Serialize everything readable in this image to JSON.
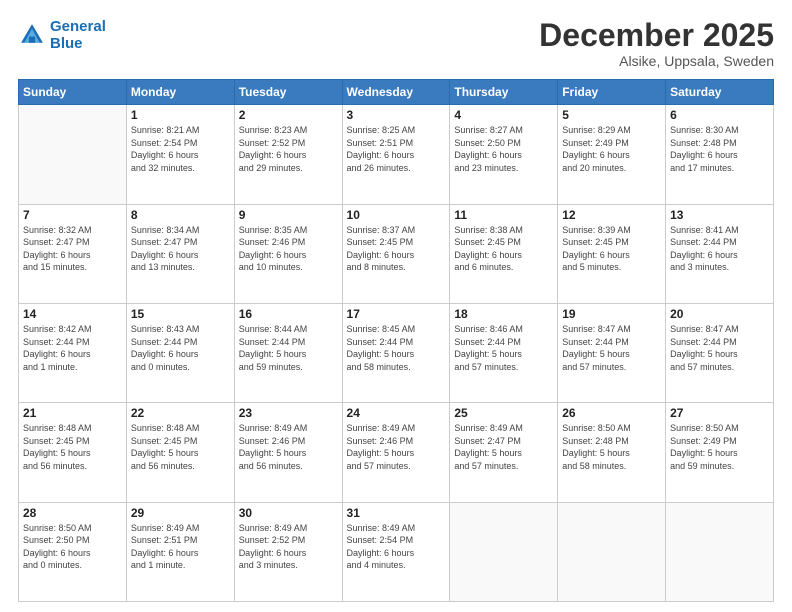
{
  "logo": {
    "line1": "General",
    "line2": "Blue"
  },
  "title": "December 2025",
  "subtitle": "Alsike, Uppsala, Sweden",
  "weekdays": [
    "Sunday",
    "Monday",
    "Tuesday",
    "Wednesday",
    "Thursday",
    "Friday",
    "Saturday"
  ],
  "weeks": [
    [
      {
        "day": "",
        "info": ""
      },
      {
        "day": "1",
        "info": "Sunrise: 8:21 AM\nSunset: 2:54 PM\nDaylight: 6 hours\nand 32 minutes."
      },
      {
        "day": "2",
        "info": "Sunrise: 8:23 AM\nSunset: 2:52 PM\nDaylight: 6 hours\nand 29 minutes."
      },
      {
        "day": "3",
        "info": "Sunrise: 8:25 AM\nSunset: 2:51 PM\nDaylight: 6 hours\nand 26 minutes."
      },
      {
        "day": "4",
        "info": "Sunrise: 8:27 AM\nSunset: 2:50 PM\nDaylight: 6 hours\nand 23 minutes."
      },
      {
        "day": "5",
        "info": "Sunrise: 8:29 AM\nSunset: 2:49 PM\nDaylight: 6 hours\nand 20 minutes."
      },
      {
        "day": "6",
        "info": "Sunrise: 8:30 AM\nSunset: 2:48 PM\nDaylight: 6 hours\nand 17 minutes."
      }
    ],
    [
      {
        "day": "7",
        "info": "Sunrise: 8:32 AM\nSunset: 2:47 PM\nDaylight: 6 hours\nand 15 minutes."
      },
      {
        "day": "8",
        "info": "Sunrise: 8:34 AM\nSunset: 2:47 PM\nDaylight: 6 hours\nand 13 minutes."
      },
      {
        "day": "9",
        "info": "Sunrise: 8:35 AM\nSunset: 2:46 PM\nDaylight: 6 hours\nand 10 minutes."
      },
      {
        "day": "10",
        "info": "Sunrise: 8:37 AM\nSunset: 2:45 PM\nDaylight: 6 hours\nand 8 minutes."
      },
      {
        "day": "11",
        "info": "Sunrise: 8:38 AM\nSunset: 2:45 PM\nDaylight: 6 hours\nand 6 minutes."
      },
      {
        "day": "12",
        "info": "Sunrise: 8:39 AM\nSunset: 2:45 PM\nDaylight: 6 hours\nand 5 minutes."
      },
      {
        "day": "13",
        "info": "Sunrise: 8:41 AM\nSunset: 2:44 PM\nDaylight: 6 hours\nand 3 minutes."
      }
    ],
    [
      {
        "day": "14",
        "info": "Sunrise: 8:42 AM\nSunset: 2:44 PM\nDaylight: 6 hours\nand 1 minute."
      },
      {
        "day": "15",
        "info": "Sunrise: 8:43 AM\nSunset: 2:44 PM\nDaylight: 6 hours\nand 0 minutes."
      },
      {
        "day": "16",
        "info": "Sunrise: 8:44 AM\nSunset: 2:44 PM\nDaylight: 5 hours\nand 59 minutes."
      },
      {
        "day": "17",
        "info": "Sunrise: 8:45 AM\nSunset: 2:44 PM\nDaylight: 5 hours\nand 58 minutes."
      },
      {
        "day": "18",
        "info": "Sunrise: 8:46 AM\nSunset: 2:44 PM\nDaylight: 5 hours\nand 57 minutes."
      },
      {
        "day": "19",
        "info": "Sunrise: 8:47 AM\nSunset: 2:44 PM\nDaylight: 5 hours\nand 57 minutes."
      },
      {
        "day": "20",
        "info": "Sunrise: 8:47 AM\nSunset: 2:44 PM\nDaylight: 5 hours\nand 57 minutes."
      }
    ],
    [
      {
        "day": "21",
        "info": "Sunrise: 8:48 AM\nSunset: 2:45 PM\nDaylight: 5 hours\nand 56 minutes."
      },
      {
        "day": "22",
        "info": "Sunrise: 8:48 AM\nSunset: 2:45 PM\nDaylight: 5 hours\nand 56 minutes."
      },
      {
        "day": "23",
        "info": "Sunrise: 8:49 AM\nSunset: 2:46 PM\nDaylight: 5 hours\nand 56 minutes."
      },
      {
        "day": "24",
        "info": "Sunrise: 8:49 AM\nSunset: 2:46 PM\nDaylight: 5 hours\nand 57 minutes."
      },
      {
        "day": "25",
        "info": "Sunrise: 8:49 AM\nSunset: 2:47 PM\nDaylight: 5 hours\nand 57 minutes."
      },
      {
        "day": "26",
        "info": "Sunrise: 8:50 AM\nSunset: 2:48 PM\nDaylight: 5 hours\nand 58 minutes."
      },
      {
        "day": "27",
        "info": "Sunrise: 8:50 AM\nSunset: 2:49 PM\nDaylight: 5 hours\nand 59 minutes."
      }
    ],
    [
      {
        "day": "28",
        "info": "Sunrise: 8:50 AM\nSunset: 2:50 PM\nDaylight: 6 hours\nand 0 minutes."
      },
      {
        "day": "29",
        "info": "Sunrise: 8:49 AM\nSunset: 2:51 PM\nDaylight: 6 hours\nand 1 minute."
      },
      {
        "day": "30",
        "info": "Sunrise: 8:49 AM\nSunset: 2:52 PM\nDaylight: 6 hours\nand 3 minutes."
      },
      {
        "day": "31",
        "info": "Sunrise: 8:49 AM\nSunset: 2:54 PM\nDaylight: 6 hours\nand 4 minutes."
      },
      {
        "day": "",
        "info": ""
      },
      {
        "day": "",
        "info": ""
      },
      {
        "day": "",
        "info": ""
      }
    ]
  ]
}
